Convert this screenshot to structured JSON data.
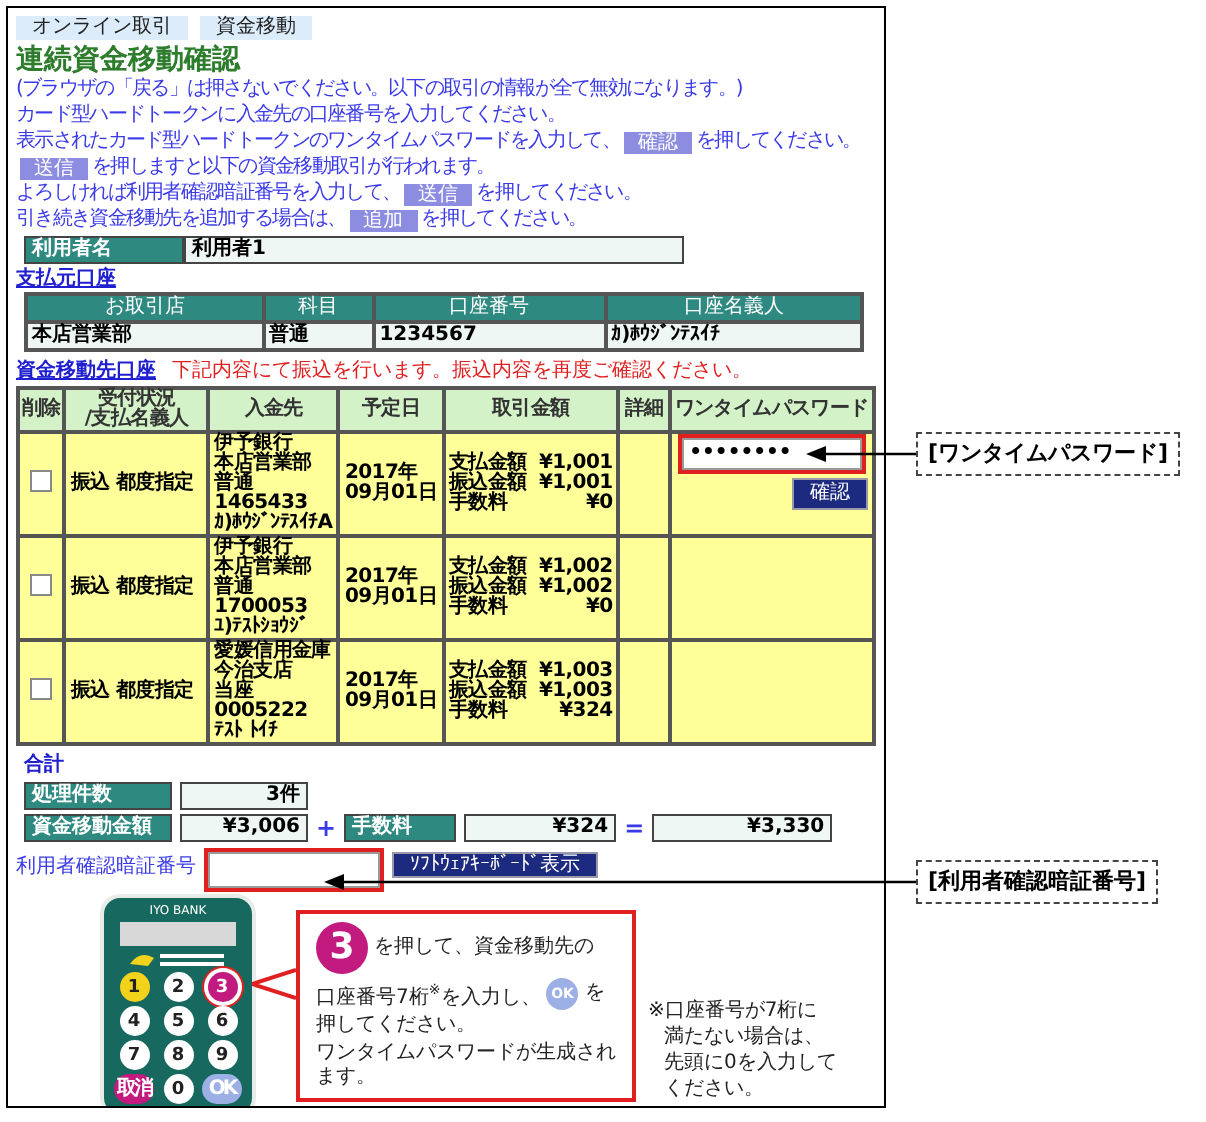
{
  "breadcrumbs": [
    "オンライン取引",
    "資金移動"
  ],
  "title": "連続資金移動確認",
  "instructions": [
    {
      "parts": [
        {
          "kind": "text",
          "text": "(ブラウザの「戻る」は押さないでください。以下の取引の情報が全て無効になります。)"
        }
      ]
    },
    {
      "parts": [
        {
          "kind": "text",
          "text": "カード型ハードトークンに入金先の口座番号を入力してください。"
        }
      ]
    },
    {
      "parts": [
        {
          "kind": "text",
          "text": "表示されたカード型ハードトークンのワンタイムパスワードを入力して、"
        },
        {
          "kind": "button",
          "text": "確認"
        },
        {
          "kind": "text",
          "text": "を押してください。"
        }
      ]
    },
    {
      "parts": [
        {
          "kind": "button",
          "text": "送信"
        },
        {
          "kind": "text",
          "text": "を押しますと以下の資金移動取引が行われます。"
        }
      ]
    },
    {
      "parts": [
        {
          "kind": "text",
          "text": "よろしければ利用者確認暗証番号を入力して、"
        },
        {
          "kind": "button",
          "text": "送信"
        },
        {
          "kind": "text",
          "text": "を押してください。"
        }
      ]
    },
    {
      "parts": [
        {
          "kind": "text",
          "text": "引き続き資金移動先を追加する場合は、"
        },
        {
          "kind": "button",
          "text": "追加"
        },
        {
          "kind": "text",
          "text": "を押してください。"
        }
      ]
    }
  ],
  "user": {
    "label": "利用者名",
    "value": "利用者1"
  },
  "source": {
    "heading": "支払元口座",
    "columns": [
      "お取引店",
      "科目",
      "口座番号",
      "口座名義人"
    ],
    "row": [
      "本店営業部",
      "普通",
      "1234567",
      "ｶ)ﾎｳｼﾞﾝﾃｽｲﾁ"
    ]
  },
  "destinations": {
    "heading": "資金移動先口座",
    "notice": "下記内容にて振込を行います。振込内容を再度ご確認ください。",
    "columns": [
      "削除",
      "受付状況\n/支払名義人",
      "入金先",
      "予定日",
      "取引金額",
      "詳細",
      "ワンタイムパスワード"
    ],
    "rows": [
      {
        "checked": false,
        "status": "振込 都度指定",
        "payee": [
          "伊予銀行",
          "本店営業部",
          "普通",
          "1465433",
          "ｶ)ﾎｳｼﾞﾝﾃｽｲﾁA"
        ],
        "date": [
          "2017年",
          "09月01日"
        ],
        "amounts": [
          {
            "label": "支払金額",
            "value": "¥1,001"
          },
          {
            "label": "振込金額",
            "value": "¥1,001"
          },
          {
            "label": "手数料",
            "value": "¥0"
          }
        ],
        "otp": {
          "value": "••••••••",
          "button": "確認"
        }
      },
      {
        "checked": false,
        "status": "振込 都度指定",
        "payee": [
          "伊予銀行",
          "本店営業部",
          "普通",
          "1700053",
          "ﾕ)ﾃｽﾄｼｮｳｼﾞ"
        ],
        "date": [
          "2017年",
          "09月01日"
        ],
        "amounts": [
          {
            "label": "支払金額",
            "value": "¥1,002"
          },
          {
            "label": "振込金額",
            "value": "¥1,002"
          },
          {
            "label": "手数料",
            "value": "¥0"
          }
        ]
      },
      {
        "checked": false,
        "status": "振込 都度指定",
        "payee": [
          "愛媛信用金庫",
          "今治支店",
          "当座",
          "0005222",
          "ﾃｽﾄ ﾄｲﾁ"
        ],
        "date": [
          "2017年",
          "09月01日"
        ],
        "amounts": [
          {
            "label": "支払金額",
            "value": "¥1,003"
          },
          {
            "label": "振込金額",
            "value": "¥1,003"
          },
          {
            "label": "手数料",
            "value": "¥324"
          }
        ]
      }
    ]
  },
  "totals": {
    "heading": "合計",
    "count": {
      "label": "処理件数",
      "value": "3件"
    },
    "amount": {
      "label": "資金移動金額",
      "value": "¥3,006"
    },
    "plus": "+",
    "fee": {
      "label": "手数料",
      "value": "¥324"
    },
    "equals": "=",
    "total": "¥3,330"
  },
  "pin": {
    "label": "利用者確認暗証番号",
    "keyboard_button": "ｿﾌﾄｳｪｱｷｰﾎﾞｰﾄﾞ表示"
  },
  "token": {
    "brand": "IYO BANK",
    "keys": [
      {
        "label": "1",
        "kind": "yellow",
        "highlighted": false
      },
      {
        "label": "2",
        "kind": "white",
        "highlighted": false
      },
      {
        "label": "3",
        "kind": "magenta",
        "highlighted": true
      },
      {
        "label": "4",
        "kind": "white",
        "highlighted": false
      },
      {
        "label": "5",
        "kind": "white",
        "highlighted": false
      },
      {
        "label": "6",
        "kind": "white",
        "highlighted": false
      },
      {
        "label": "7",
        "kind": "white",
        "highlighted": false
      },
      {
        "label": "8",
        "kind": "white",
        "highlighted": false
      },
      {
        "label": "9",
        "kind": "white",
        "highlighted": false
      },
      {
        "label": "取消",
        "kind": "magenta",
        "highlighted": false
      },
      {
        "label": "0",
        "kind": "white",
        "highlighted": false
      },
      {
        "label": "OK",
        "kind": "blue",
        "highlighted": false
      }
    ]
  },
  "callout": {
    "step": "3",
    "line1": "を押して、資金移動先の",
    "line2": "口座番号7桁$^{※}$を入力し、",
    "ok_key": "OK",
    "line2_end": "を",
    "line3": "押してください。",
    "line4": "ワンタイムパスワードが生成されます。"
  },
  "note": [
    "※口座番号が7桁に",
    "満たない場合は、",
    "先頭に0を入力して",
    "ください。"
  ],
  "annotations": [
    {
      "kind": "otp",
      "text": "[ワンタイムパスワード]"
    },
    {
      "kind": "pin",
      "text": "[利用者確認暗証番号]"
    }
  ]
}
